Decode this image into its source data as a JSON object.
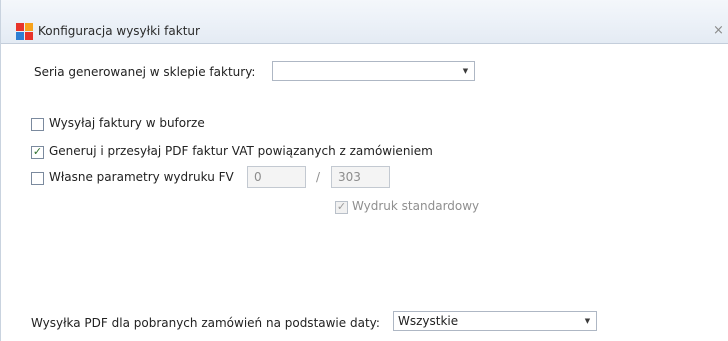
{
  "window": {
    "title": "Konfiguracja wysyłki faktur",
    "close_glyph": "×",
    "icon": "app-logo-icon",
    "accent_colors": [
      "#e8332a",
      "#f7a21b",
      "#6ab04c",
      "#2f7fd3"
    ]
  },
  "series": {
    "label": "Seria generowanej w sklepie faktury:",
    "value": ""
  },
  "options": {
    "buffer_label": "Wysyłaj faktury w buforze",
    "buffer_checked": false,
    "pdf_label": "Generuj i przesyłaj PDF faktur VAT powiązanych z zamówieniem",
    "pdf_checked": true,
    "print_params_label": "Własne parametry wydruku FV",
    "print_params_checked": false,
    "param_a": "0",
    "separator": "/",
    "param_b": "303",
    "standard_print_label": "Wydruk standardowy",
    "standard_print_checked": true
  },
  "date_send": {
    "label": "Wysyłka PDF dla pobranych zamówień na podstawie daty:",
    "value": "Wszystkie"
  }
}
